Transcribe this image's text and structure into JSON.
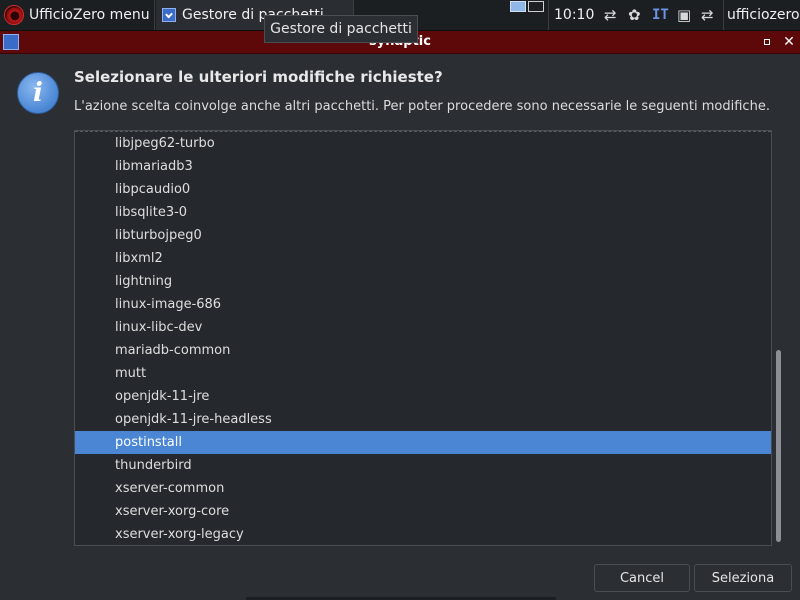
{
  "panel": {
    "menu_label": "UfficioZero menu",
    "task_label": "Gestore di pacchetti",
    "clock": "10:10",
    "lang": "IT",
    "user": "ufficiozero",
    "tooltip": "Gestore di pacchetti"
  },
  "window": {
    "title": "synaptic",
    "close_glyph": "✕"
  },
  "dialog": {
    "icon_glyph": "i",
    "title": "Selezionare le ulteriori modifiche richieste?",
    "description": "L'azione scelta coinvolge anche altri pacchetti. Per poter procedere sono necessarie le seguenti modifiche.",
    "packages": [
      "libjpeg62-turbo",
      "libmariadb3",
      "libpcaudio0",
      "libsqlite3-0",
      "libturbojpeg0",
      "libxml2",
      "lightning",
      "linux-image-686",
      "linux-libc-dev",
      "mariadb-common",
      "mutt",
      "openjdk-11-jre",
      "openjdk-11-jre-headless",
      "postinstall",
      "thunderbird",
      "xserver-common",
      "xserver-xorg-core",
      "xserver-xorg-legacy"
    ],
    "selected_package": "postinstall",
    "cancel_label": "Cancel",
    "confirm_label": "Seleziona"
  },
  "icons": {
    "network_glyph": "⇄",
    "flower_glyph": "✿",
    "image_glyph": "▣"
  }
}
